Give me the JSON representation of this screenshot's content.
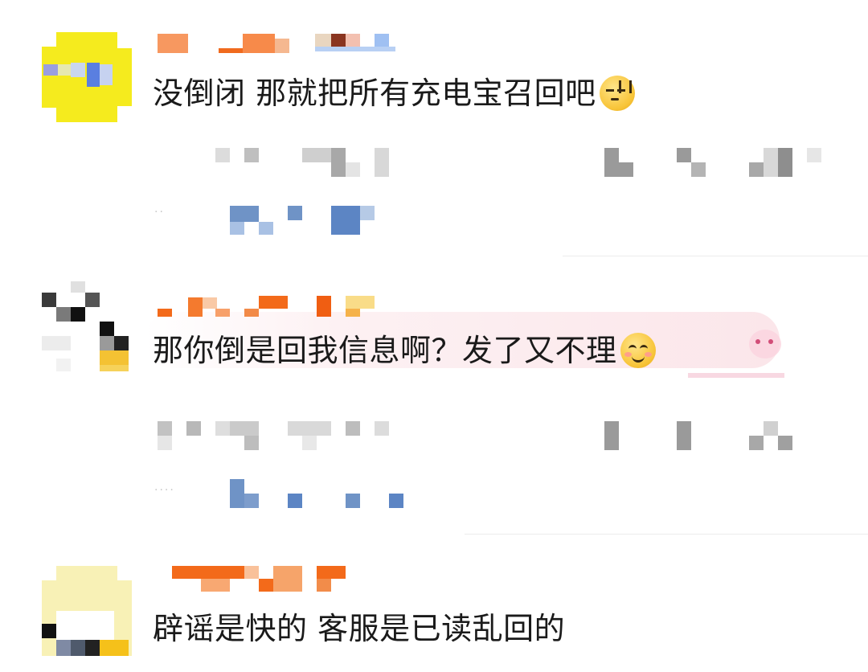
{
  "comments": [
    {
      "text": "没倒闭 那就把所有充电宝召回吧",
      "emoji": "sweat-face-icon",
      "has_bubble": false
    },
    {
      "text": "那你倒是回我信息啊？发了又不理",
      "emoji": "smiling-face-icon",
      "has_bubble": true
    },
    {
      "text": "辟谣是快的 客服是已读乱回的",
      "emoji": "",
      "has_bubble": false
    }
  ],
  "colors": {
    "text": "#1a1a1a",
    "username_orange": "#f5731f",
    "link_blue": "#4a7fc1",
    "meta_gray": "#bdbdbd",
    "bubble_pink": "#fbe6ea"
  }
}
